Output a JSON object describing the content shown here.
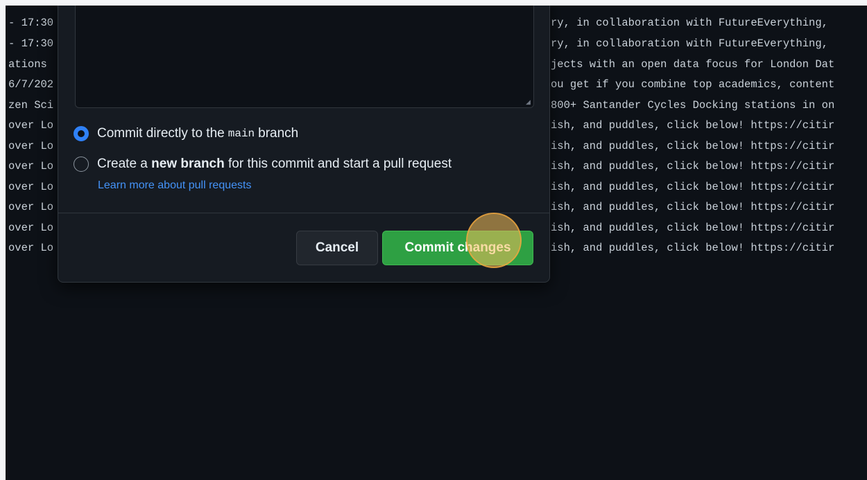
{
  "background_terminal": {
    "left_lines": [
      "- 17:30",
      "- 17:30",
      "ations ",
      "6/7/202",
      "zen Sci",
      "over Lo",
      "over Lo",
      "over Lo",
      "over Lo",
      "over Lo",
      "over Lo",
      "over Lo"
    ],
    "right_lines": [
      "ry, in collaboration with FutureEverything,",
      "ry, in collaboration with FutureEverything,",
      "jects with an open data focus for London Dat",
      "ou get if you combine top academics, content",
      "800+ Santander Cycles Docking stations in on",
      "ish, and puddles, click below! https://citir",
      "ish, and puddles, click below! https://citir",
      "ish, and puddles, click below! https://citir",
      "ish, and puddles, click below! https://citir",
      "ish, and puddles, click below! https://citir",
      "ish, and puddles, click below! https://citir",
      "ish, and puddles, click below! https://citir"
    ]
  },
  "commit_dialog": {
    "option_direct": {
      "text_before": "Commit directly to the",
      "branch_name": "main",
      "text_after": "branch",
      "checked": true
    },
    "option_new_branch": {
      "text_before": "Create a",
      "bold_text": "new branch",
      "text_after": "for this commit and start a pull request",
      "checked": false
    },
    "learn_more_link": "Learn more about pull requests",
    "cancel_label": "Cancel",
    "commit_label": "Commit changes",
    "resize_glyph": "◢"
  },
  "colors": {
    "accent_blue": "#2f81f7",
    "link_blue": "#4493f8",
    "commit_green": "#2ea043",
    "page_bg": "#0d1117",
    "dialog_bg": "#161b22"
  }
}
